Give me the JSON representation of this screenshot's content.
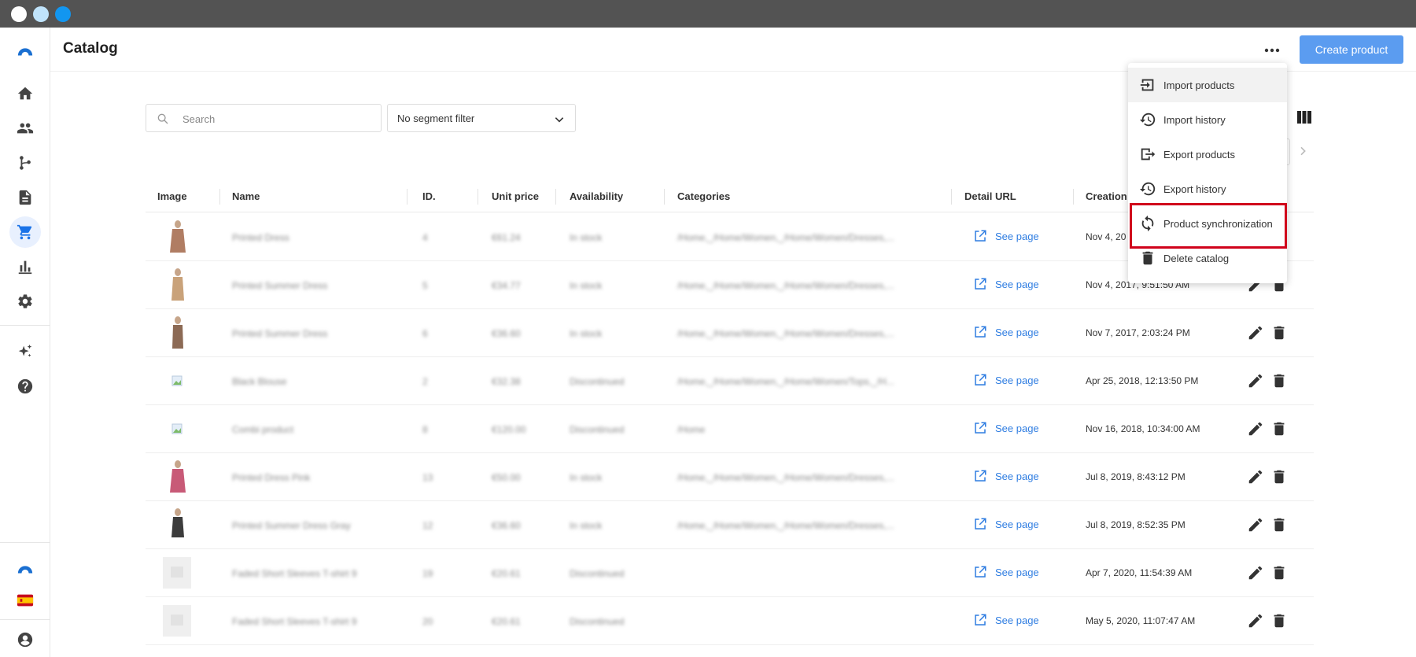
{
  "header": {
    "title": "Catalog",
    "create_label": "Create product"
  },
  "toolbar": {
    "search_placeholder": "Search",
    "segment_filter": "No segment filter"
  },
  "table": {
    "columns": [
      "Image",
      "Name",
      "ID.",
      "Unit price",
      "Availability",
      "Categories",
      "Detail URL",
      "Creation"
    ],
    "rows": [
      {
        "name": "Printed Dress",
        "id": "4",
        "price": "€61.24",
        "availability": "In stock",
        "categories": "/Home,_/Home/Women,_/Home/Women/Dresses,...",
        "link": "See page",
        "creation": "Nov 4, 20"
      },
      {
        "name": "Printed Summer Dress",
        "id": "5",
        "price": "€34.77",
        "availability": "In stock",
        "categories": "/Home,_/Home/Women,_/Home/Women/Dresses,...",
        "link": "See page",
        "creation": "Nov 4, 2017, 9:51:50 AM"
      },
      {
        "name": "Printed Summer Dress",
        "id": "6",
        "price": "€36.60",
        "availability": "In stock",
        "categories": "/Home,_/Home/Women,_/Home/Women/Dresses,...",
        "link": "See page",
        "creation": "Nov 7, 2017, 2:03:24 PM"
      },
      {
        "name": "Black Blouse",
        "id": "2",
        "price": "€32.38",
        "availability": "Discontinued",
        "categories": "/Home,_/Home/Women,_/Home/Women/Tops,_/H...",
        "link": "See page",
        "creation": "Apr 25, 2018, 12:13:50 PM"
      },
      {
        "name": "Combi product",
        "id": "8",
        "price": "€120.00",
        "availability": "Discontinued",
        "categories": "/Home",
        "link": "See page",
        "creation": "Nov 16, 2018, 10:34:00 AM"
      },
      {
        "name": "Printed Dress Pink",
        "id": "13",
        "price": "€50.00",
        "availability": "In stock",
        "categories": "/Home,_/Home/Women,_/Home/Women/Dresses,...",
        "link": "See page",
        "creation": "Jul 8, 2019, 8:43:12 PM"
      },
      {
        "name": "Printed Summer Dress Gray",
        "id": "12",
        "price": "€36.60",
        "availability": "In stock",
        "categories": "/Home,_/Home/Women,_/Home/Women/Dresses,...",
        "link": "See page",
        "creation": "Jul 8, 2019, 8:52:35 PM"
      },
      {
        "name": "Faded Short Sleeves T-shirt 9",
        "id": "19",
        "price": "€20.61",
        "availability": "Discontinued",
        "categories": "",
        "link": "See page",
        "creation": "Apr 7, 2020, 11:54:39 AM"
      },
      {
        "name": "Faded Short Sleeves T-shirt 9",
        "id": "20",
        "price": "€20.61",
        "availability": "Discontinued",
        "categories": "",
        "link": "See page",
        "creation": "May 5, 2020, 11:07:47 AM"
      }
    ]
  },
  "menu": {
    "items": [
      {
        "label": "Import products",
        "icon": "import-icon"
      },
      {
        "label": "Import history",
        "icon": "history-icon"
      },
      {
        "label": "Export products",
        "icon": "export-icon"
      },
      {
        "label": "Export history",
        "icon": "history-icon"
      },
      {
        "label": "Product synchronization",
        "icon": "sync-icon"
      },
      {
        "label": "Delete catalog",
        "icon": "trash-icon"
      }
    ]
  },
  "colors": {
    "accent": "#5b9cf0",
    "link": "#2f7de1",
    "highlight": "#d0021b",
    "titlebar": "#535353"
  }
}
